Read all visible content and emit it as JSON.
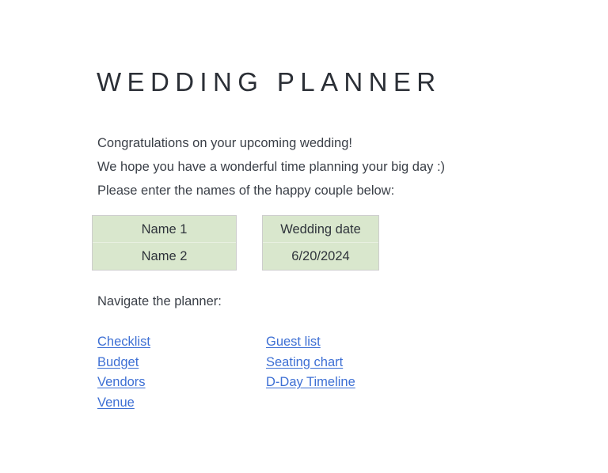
{
  "document": {
    "title": "WEDDING PLANNER",
    "background_color": "#ffffff",
    "text_color": "#3a3f47"
  },
  "intro": {
    "lines": [
      "Congratulations on your upcoming wedding!",
      "We hope you have a wonderful time planning your big day :)",
      "Please enter the names of the happy couple below:"
    ]
  },
  "entry": {
    "names_table": {
      "accent_color": "#d9e7cd",
      "cells": [
        "Name 1",
        "Name 2"
      ]
    },
    "date_table": {
      "accent_color": "#d9e7cd",
      "header": "Wedding date",
      "value": "6/20/2024"
    }
  },
  "navigation": {
    "heading": "Navigate the planner:",
    "link_color": "#3d6fd4",
    "left_column": [
      "Checklist",
      "Budget",
      "Vendors",
      "Venue"
    ],
    "right_column": [
      "Guest list",
      "Seating chart",
      "D-Day Timeline"
    ]
  }
}
